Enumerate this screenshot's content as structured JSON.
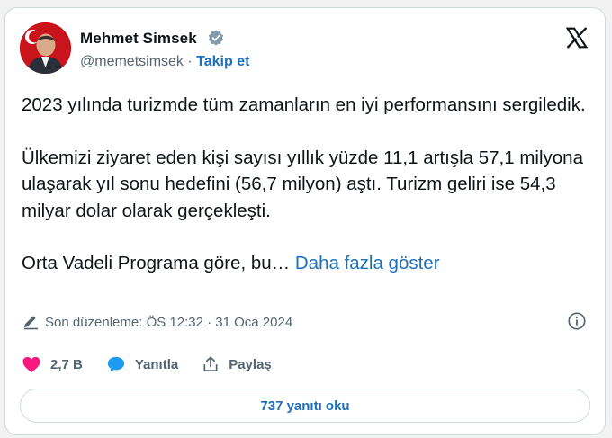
{
  "author": {
    "name": "Mehmet Simsek",
    "handle": "@memetsimsek",
    "separator": "·",
    "follow_label": "Takip et"
  },
  "tweet": {
    "paragraphs": [
      "2023 yılında turizmde tüm zamanların en iyi performansını sergiledik.",
      "Ülkemizi ziyaret eden kişi sayısı yıllık yüzde 11,1 artışla 57,1 milyona ulaşarak yıl sonu hedefini (56,7 milyon) aştı. Turizm geliri ise 54,3 milyar dolar olarak gerçekleşti."
    ],
    "truncated_text": "Orta Vadeli Programa göre, bu…",
    "show_more_label": "Daha fazla göster"
  },
  "edited": {
    "label": "Son düzenleme: ÖS 12:32 · 31 Oca 2024"
  },
  "actions": {
    "like_count": "2,7 B",
    "reply_label": "Yanıtla",
    "share_label": "Paylaş"
  },
  "read_replies_label": "737 yanıtı oku",
  "colors": {
    "accent": "#1d6fb8",
    "like": "#f91880",
    "reply": "#1d9bf0",
    "verified": "#829aab",
    "muted": "#536471"
  },
  "icons": [
    "verified-badge-icon",
    "x-logo-icon",
    "pencil-icon",
    "info-icon",
    "heart-icon",
    "speech-bubble-icon",
    "share-icon"
  ]
}
